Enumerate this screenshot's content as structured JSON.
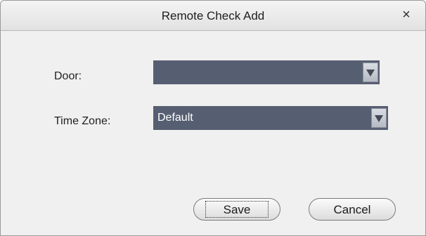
{
  "dialog": {
    "title": "Remote Check Add",
    "close_glyph": "×"
  },
  "form": {
    "door": {
      "label": "Door:",
      "value": ""
    },
    "time_zone": {
      "label": "Time Zone:",
      "value": "Default"
    }
  },
  "buttons": {
    "save_label": "Save",
    "cancel_label": "Cancel"
  },
  "icons": {
    "close": "close-icon",
    "dropdown": "chevron-down-icon"
  }
}
